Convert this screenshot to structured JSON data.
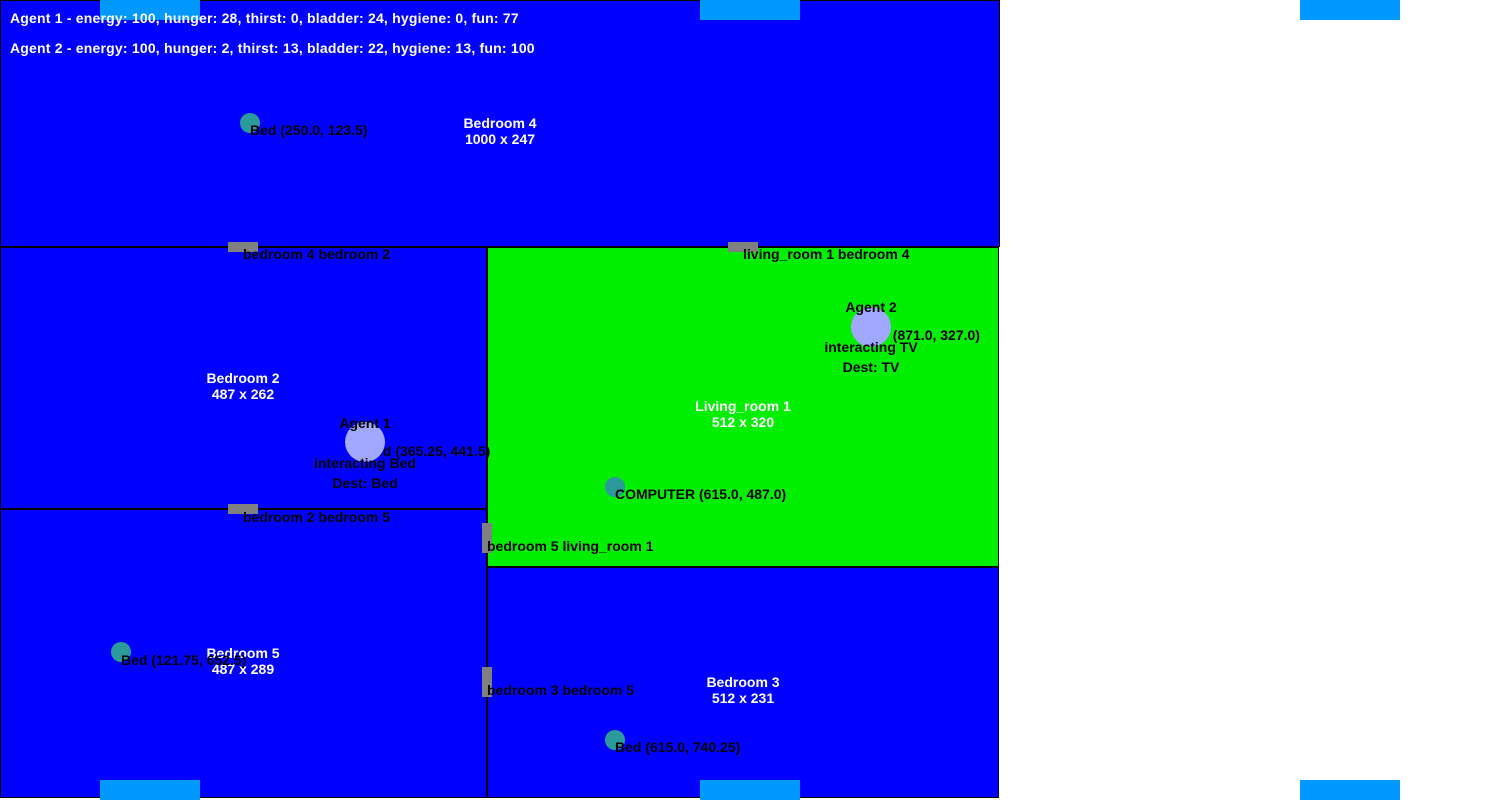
{
  "status": {
    "agent1": "Agent 1 - energy: 100, hunger: 28, thirst: 0, bladder: 24, hygiene: 0, fun: 77",
    "agent2": "Agent 2 - energy: 100, hunger: 2, thirst: 13, bladder: 22, hygiene: 13, fun: 100"
  },
  "rooms": {
    "bedroom4": {
      "name": "Bedroom 4",
      "size": "1000 x 247"
    },
    "bedroom2": {
      "name": "Bedroom 2",
      "size": "487 x 262"
    },
    "living_room1": {
      "name": "Living_room 1",
      "size": "512 x 320"
    },
    "bedroom5": {
      "name": "Bedroom 5",
      "size": "487 x 289"
    },
    "bedroom3": {
      "name": "Bedroom 3",
      "size": "512 x 231"
    }
  },
  "doors": {
    "d1": "bedroom 4 bedroom 2",
    "d2": "living_room 1 bedroom 4",
    "d3": "bedroom 2 bedroom 5",
    "d4": "bedroom 5 living_room 1",
    "d5": "bedroom 3 bedroom 5"
  },
  "objects": {
    "bed_b4": "Bed (250.0, 123.5)",
    "computer": "COMPUTER (615.0, 487.0)",
    "bed_b5": "Bed (121.75, 652.5)",
    "bed_b3": "Bed (615.0, 740.25)",
    "bed_b2": "Bed (365.25, 441.5)",
    "tv": "TV (871.0, 327.0)"
  },
  "agents": {
    "agent1": {
      "name": "Agent 1",
      "action": "interacting Bed",
      "dest": "Dest: Bed"
    },
    "agent2": {
      "name": "Agent 2",
      "action": "interacting TV",
      "dest": "Dest: TV"
    }
  },
  "colors": {
    "bedroom": "#0000ff",
    "living_room": "#00ee00",
    "window": "#0099ff",
    "door": "#808080",
    "agent": "#a0a8ff",
    "object": "#2a9a9a"
  }
}
